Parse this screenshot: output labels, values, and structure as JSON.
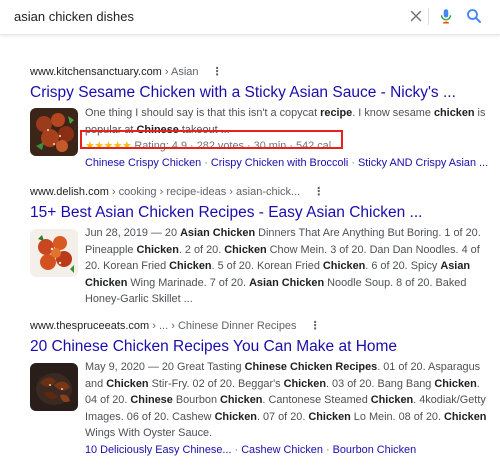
{
  "search": {
    "query": "asian chicken dishes"
  },
  "results": [
    {
      "cite_domain": "www.kitchensanctuary.com",
      "cite_path": " › Asian",
      "title": "Crispy Sesame Chicken with a Sticky Asian Sauce - Nicky's ...",
      "snippet_parts": [
        {
          "t": "One thing I should say is that this isn't a copycat ",
          "b": false
        },
        {
          "t": "recipe",
          "b": true
        },
        {
          "t": ". I know sesame ",
          "b": false
        },
        {
          "t": "chicken",
          "b": true
        },
        {
          "t": " is popular at ",
          "b": false
        },
        {
          "t": "Chinese",
          "b": true
        },
        {
          "t": " takeout ...",
          "b": false
        }
      ],
      "rating": {
        "stars_text": "★★★★★",
        "rating_label": "Rating: 4.9",
        "votes": "282 votes",
        "time": "30 min",
        "calories": "542 cal",
        "value": 4.9
      },
      "sitelinks": [
        "Chinese Crispy Chicken",
        "Crispy Chicken with Broccoli",
        "Sticky AND Crispy Asian ..."
      ]
    },
    {
      "cite_domain": "www.delish.com",
      "cite_path": " › cooking › recipe-ideas › asian-chick...",
      "title": "15+ Best Asian Chicken Recipes - Easy Asian Chicken ...",
      "snippet_parts": [
        {
          "t": "Jun 28, 2019 — 20 ",
          "b": false
        },
        {
          "t": "Asian Chicken",
          "b": true
        },
        {
          "t": " Dinners That Are Anything But Boring. 1 of 20. Pineapple ",
          "b": false
        },
        {
          "t": "Chicken",
          "b": true
        },
        {
          "t": ". 2 of 20. ",
          "b": false
        },
        {
          "t": "Chicken",
          "b": true
        },
        {
          "t": " Chow Mein. 3 of 20. Dan Dan Noodles. 4 of 20. Korean Fried ",
          "b": false
        },
        {
          "t": "Chicken",
          "b": true
        },
        {
          "t": ". 5 of 20. Korean Fried ",
          "b": false
        },
        {
          "t": "Chicken",
          "b": true
        },
        {
          "t": ". 6 of 20. Spicy ",
          "b": false
        },
        {
          "t": "Asian Chicken",
          "b": true
        },
        {
          "t": " Wing Marinade. 7 of 20. ",
          "b": false
        },
        {
          "t": "Asian Chicken",
          "b": true
        },
        {
          "t": " Noodle Soup. 8 of 20. Baked Honey-Garlic Skillet ...",
          "b": false
        }
      ]
    },
    {
      "cite_domain": "www.thespruceeats.com",
      "cite_path": " › ... › Chinese Dinner Recipes",
      "title": "20 Chinese Chicken Recipes You Can Make at Home",
      "snippet_parts": [
        {
          "t": "May 9, 2020 — 20 Great Tasting ",
          "b": false
        },
        {
          "t": "Chinese Chicken Recipes",
          "b": true
        },
        {
          "t": ". 01 of 20. Asparagus and ",
          "b": false
        },
        {
          "t": "Chicken",
          "b": true
        },
        {
          "t": " Stir-Fry. 02 of 20. Beggar's ",
          "b": false
        },
        {
          "t": "Chicken",
          "b": true
        },
        {
          "t": ". 03 of 20. Bang Bang ",
          "b": false
        },
        {
          "t": "Chicken",
          "b": true
        },
        {
          "t": ". 04 of 20. ",
          "b": false
        },
        {
          "t": "Chinese",
          "b": true
        },
        {
          "t": " Bourbon ",
          "b": false
        },
        {
          "t": "Chicken",
          "b": true
        },
        {
          "t": ". Cantonese Steamed ",
          "b": false
        },
        {
          "t": "Chicken",
          "b": true
        },
        {
          "t": ". 4kodiak/Getty Images. 06 of 20. Cashew ",
          "b": false
        },
        {
          "t": "Chicken",
          "b": true
        },
        {
          "t": ". 07 of 20. ",
          "b": false
        },
        {
          "t": "Chicken",
          "b": true
        },
        {
          "t": " Lo Mein. 08 of 20. ",
          "b": false
        },
        {
          "t": "Chicken",
          "b": true
        },
        {
          "t": " Wings With Oyster Sauce.",
          "b": false
        }
      ],
      "sitelinks": [
        "10 Deliciously Easy Chinese...",
        "Cashew Chicken",
        "Bourbon Chicken"
      ]
    }
  ],
  "colors": {
    "link": "#1a0dab",
    "snippet": "#4d5156",
    "star": "#fbbc04",
    "highlight_box": "#e8211a"
  },
  "icons": [
    "close-icon",
    "microphone-icon",
    "search-icon",
    "more-options-icon"
  ]
}
